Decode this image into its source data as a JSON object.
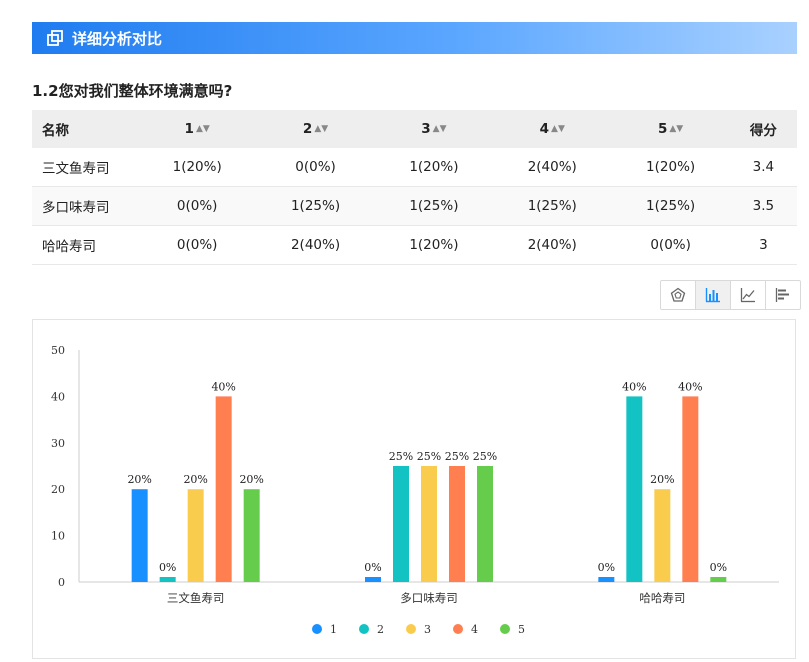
{
  "header": {
    "title": "详细分析对比",
    "icon": "compare-icon"
  },
  "question": "1.2您对我们整体环境满意吗?",
  "table": {
    "headers": [
      "名称",
      "1",
      "2",
      "3",
      "4",
      "5",
      "得分"
    ],
    "rows": [
      {
        "name": "三文鱼寿司",
        "cells": [
          "1(20%)",
          "0(0%)",
          "1(20%)",
          "2(40%)",
          "1(20%)"
        ],
        "score": "3.4"
      },
      {
        "name": "多口味寿司",
        "cells": [
          "0(0%)",
          "1(25%)",
          "1(25%)",
          "1(25%)",
          "1(25%)"
        ],
        "score": "3.5"
      },
      {
        "name": "哈哈寿司",
        "cells": [
          "0(0%)",
          "2(40%)",
          "1(20%)",
          "2(40%)",
          "0(0%)"
        ],
        "score": "3"
      }
    ]
  },
  "toolbar": {
    "buttons": [
      "radar-chart-icon",
      "bar-chart-icon",
      "line-chart-icon",
      "horizontal-bar-chart-icon"
    ],
    "active": 1
  },
  "chart_data": {
    "type": "bar",
    "categories": [
      "三文鱼寿司",
      "多口味寿司",
      "哈哈寿司"
    ],
    "series": [
      {
        "name": "1",
        "color": "#1890ff",
        "values": [
          20,
          0,
          0
        ]
      },
      {
        "name": "2",
        "color": "#13c2c2",
        "values": [
          0,
          25,
          40
        ]
      },
      {
        "name": "3",
        "color": "#facc4e",
        "values": [
          20,
          25,
          20
        ]
      },
      {
        "name": "4",
        "color": "#ff7f50",
        "values": [
          40,
          25,
          40
        ]
      },
      {
        "name": "5",
        "color": "#66cc4c",
        "values": [
          20,
          25,
          0
        ]
      }
    ],
    "data_labels": [
      [
        "20%",
        "0%",
        "0%"
      ],
      [
        "0%",
        "25%",
        "40%"
      ],
      [
        "20%",
        "25%",
        "20%"
      ],
      [
        "40%",
        "25%",
        "40%"
      ],
      [
        "20%",
        "25%",
        "0%"
      ]
    ],
    "yticks": [
      "0",
      "10",
      "20",
      "30",
      "40",
      "50"
    ],
    "ylim": [
      0,
      50
    ],
    "grid": false,
    "legend": "bottom"
  }
}
